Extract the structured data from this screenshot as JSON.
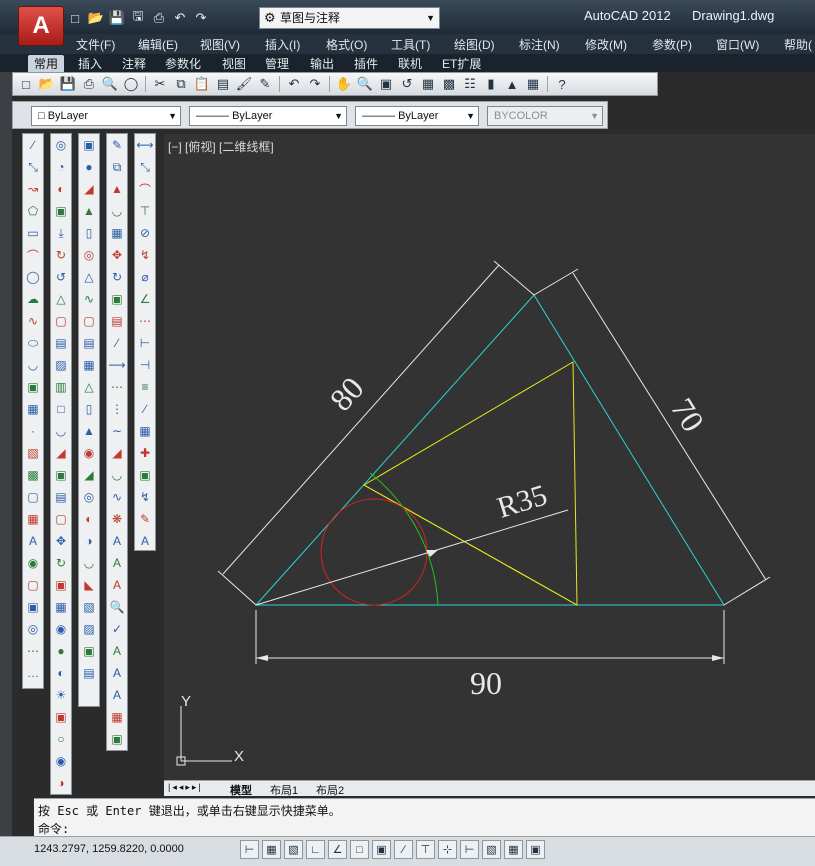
{
  "title_bar": {
    "app_logo": "A",
    "app_name": "AutoCAD 2012",
    "document_name": "Drawing1.dwg",
    "workspace": "草图与注释",
    "qat_icons": [
      "new-icon",
      "open-icon",
      "save-icon",
      "save-as-icon",
      "plot-icon",
      "undo-icon",
      "redo-icon"
    ]
  },
  "menu": [
    "文件(F)",
    "编辑(E)",
    "视图(V)",
    "插入(I)",
    "格式(O)",
    "工具(T)",
    "绘图(D)",
    "标注(N)",
    "修改(M)",
    "参数(P)",
    "窗口(W)",
    "帮助("
  ],
  "ribbon_tabs": [
    "常用",
    "插入",
    "注释",
    "参数化",
    "视图",
    "管理",
    "输出",
    "插件",
    "联机",
    "ET扩展"
  ],
  "properties": {
    "color": "ByLayer",
    "linetype": "ByLayer",
    "lineweight": "ByLayer",
    "plotstyle": "BYCOLOR"
  },
  "viewport_label": "[−] [俯视] [二维线框]",
  "drawing": {
    "dim_80": "80",
    "dim_70": "70",
    "dim_90": "90",
    "dim_r35": "R35",
    "ucs_x": "X",
    "ucs_y": "Y",
    "colors": {
      "cyan": "#2ad4d4",
      "yellow": "#e6e61a",
      "red": "#d42222",
      "green": "#22c022",
      "white": "#e8e8e8"
    }
  },
  "layout_tabs": [
    "模型",
    "布局1",
    "布局2"
  ],
  "command": {
    "line1": "按 Esc 或 Enter 键退出，或单击右键显示快捷菜单。",
    "line2": "命令:"
  },
  "status": {
    "coordinates": "1243.2797, 1259.8220, 0.0000"
  }
}
